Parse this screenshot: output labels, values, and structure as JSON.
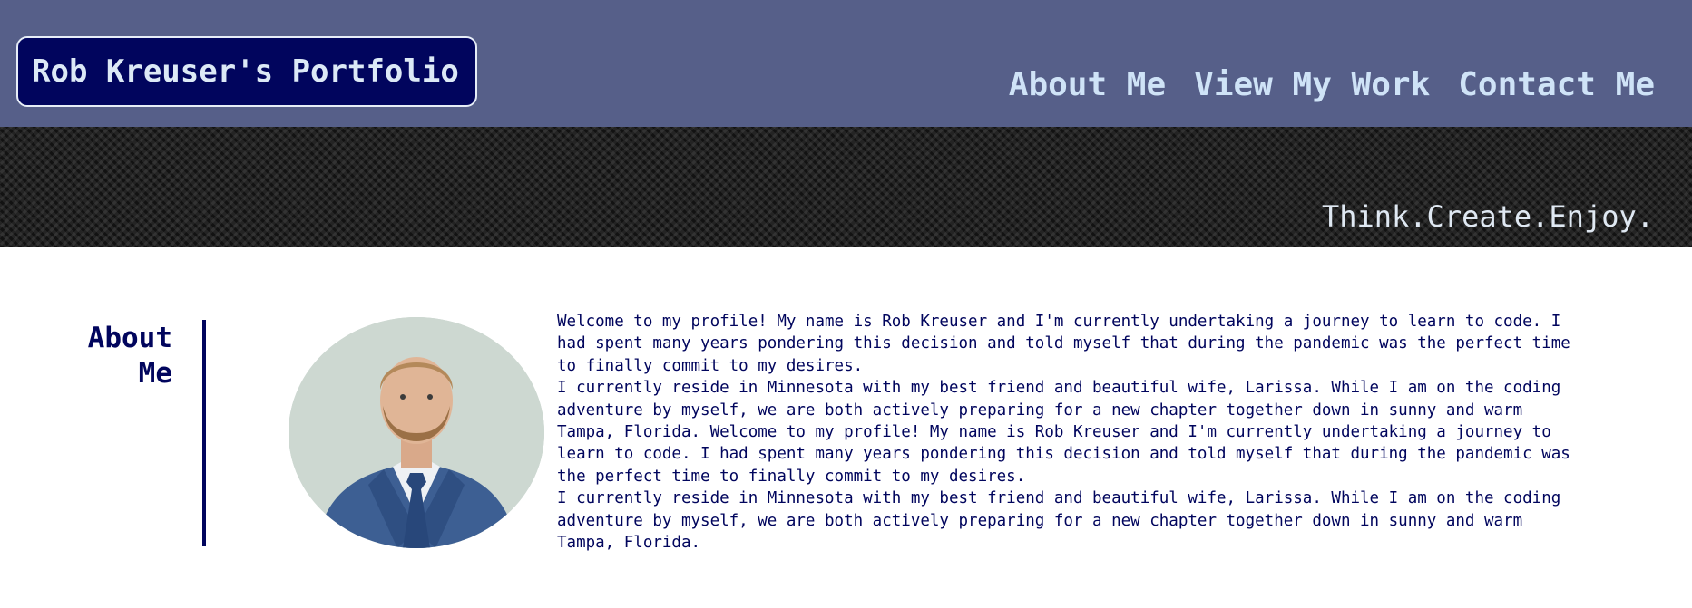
{
  "header": {
    "logo_text": "Rob Kreuser's Portfolio",
    "nav": [
      {
        "label": "About Me"
      },
      {
        "label": "View My Work"
      },
      {
        "label": "Contact Me"
      }
    ]
  },
  "hero": {
    "tagline": "Think.Create.Enjoy."
  },
  "about": {
    "heading": "About Me",
    "portrait_icon": "profile-photo-icon",
    "paragraphs": [
      "Welcome to my profile! My name is Rob Kreuser and I'm currently undertaking a journey to learn to code. I had spent many years pondering this decision and told myself that during the pandemic was the perfect time to finally commit to my desires.",
      "I currently reside in Minnesota with my best friend and beautiful wife, Larissa. While I am on the coding adventure by myself, we are both actively preparing for a new chapter together down in sunny and warm Tampa, Florida. Welcome to my profile! My name is Rob Kreuser and I'm currently undertaking a journey to learn to code. I had spent many years pondering this decision and told myself that during the pandemic was the perfect time to finally commit to my desires.",
      "I currently reside in Minnesota with my best friend and beautiful wife, Larissa. While I am on the coding adventure by myself, we are both actively preparing for a new chapter together down in sunny and warm Tampa, Florida."
    ]
  },
  "colors": {
    "header_bg": "#565f89",
    "logo_bg": "#01055d",
    "nav_text": "#cfe3f7",
    "body_text": "#01055d",
    "hero_bg": "#1b1b1b"
  }
}
